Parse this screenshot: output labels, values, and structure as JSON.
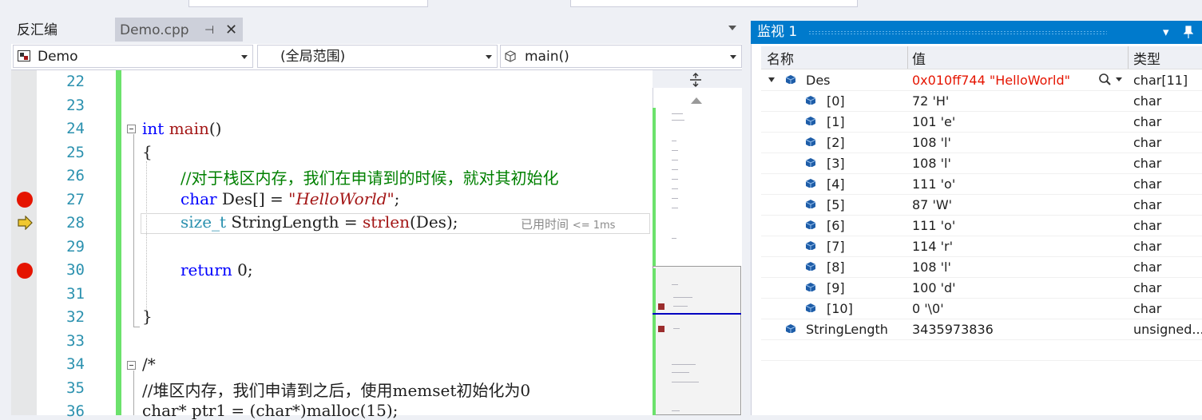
{
  "tabs": {
    "disassembly": "反汇编",
    "active_file": "Demo.cpp",
    "pin_glyph": "⊣",
    "close_glyph": "✕"
  },
  "navbar": {
    "project": "Demo",
    "scope": "(全局范围)",
    "function": "main()"
  },
  "editor": {
    "line_numbers": [
      "22",
      "23",
      "24",
      "25",
      "26",
      "27",
      "28",
      "29",
      "30",
      "31",
      "32",
      "33",
      "34",
      "35",
      "36"
    ],
    "code": {
      "l24_kw": "int",
      "l24_fn": "main",
      "l24_rest": "()",
      "l25": "{",
      "l26": "//对于栈区内存，我们在申请到的时候，就对其初始化",
      "l27_kw": "char",
      "l27_mid": " Des[] = ",
      "l27_str": "\"HelloWorld\"",
      "l27_end": ";",
      "l28_typ": "size_t",
      "l28_mid": " StringLength = ",
      "l28_fn": "strlen",
      "l28_end": "(Des);",
      "l30_kw": "return",
      "l30_end": " 0;",
      "l32": "}",
      "l34": "/*",
      "l35": "//堆区内存，我们申请到之后，使用memset初始化为0",
      "l36": "char* ptr1 = (char*)malloc(15);"
    },
    "elapsed_label": "已用时间",
    "elapsed_value": "<= 1ms",
    "breakpoint_lines": [
      "27",
      "30"
    ],
    "current_line": "28",
    "colors": {
      "keyword": "#0000ff",
      "string": "#a31515",
      "comment": "#008000",
      "type": "#2b91af",
      "breakpoint": "#e51400",
      "change_bar": "#6ce26c"
    }
  },
  "watch": {
    "title": "监视 1",
    "dropdown_glyph": "▾",
    "pin_glyph": "📌",
    "columns": {
      "name": "名称",
      "value": "值",
      "type": "类型"
    },
    "rows": [
      {
        "name": "Des",
        "value": "0x010ff744 \"HelloWorld\"",
        "type": "char[11]",
        "level": 0,
        "expanded": true,
        "changed": true
      },
      {
        "name": "[0]",
        "value": "72 'H'",
        "type": "char",
        "level": 1
      },
      {
        "name": "[1]",
        "value": "101 'e'",
        "type": "char",
        "level": 1
      },
      {
        "name": "[2]",
        "value": "108 'l'",
        "type": "char",
        "level": 1
      },
      {
        "name": "[3]",
        "value": "108 'l'",
        "type": "char",
        "level": 1
      },
      {
        "name": "[4]",
        "value": "111 'o'",
        "type": "char",
        "level": 1
      },
      {
        "name": "[5]",
        "value": "87 'W'",
        "type": "char",
        "level": 1
      },
      {
        "name": "[6]",
        "value": "111 'o'",
        "type": "char",
        "level": 1
      },
      {
        "name": "[7]",
        "value": "114 'r'",
        "type": "char",
        "level": 1
      },
      {
        "name": "[8]",
        "value": "108 'l'",
        "type": "char",
        "level": 1
      },
      {
        "name": "[9]",
        "value": "100 'd'",
        "type": "char",
        "level": 1
      },
      {
        "name": "[10]",
        "value": "0 '\\0'",
        "type": "char",
        "level": 1
      },
      {
        "name": "StringLength",
        "value": "3435973836",
        "type": "unsigned...",
        "level": 0
      }
    ]
  }
}
